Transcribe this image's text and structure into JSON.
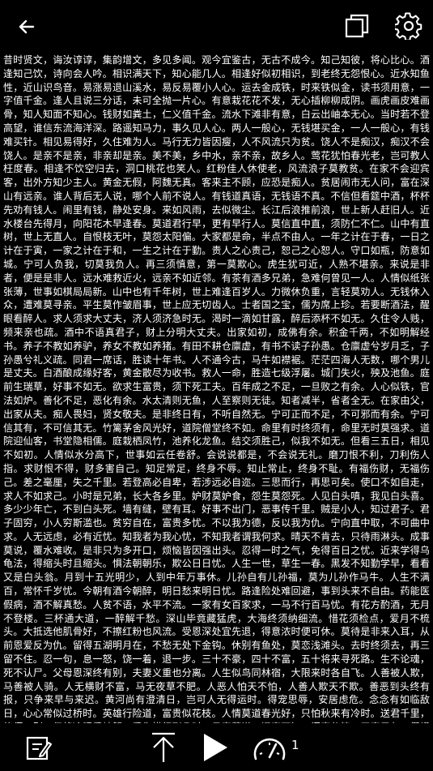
{
  "topbar": {
    "back_icon": "arrow-left-icon",
    "copy_icon": "copy-icon",
    "settings_icon": "gear-icon"
  },
  "content": {
    "text": "昔时贤文，诲汝谆谆，集韵增文，多见多闻。观今宜鉴古，无古不成今。知己知彼，将心比心。酒逢知己饮，诗向会人吟。相识满天下，知心能几人。相逢好似初相识，到老终无怨恨心。近水知鱼性，近山识鸟音。易涨易退山溪水，易反易覆小人心。运去金成铁，时来铁似金，读书须用意，一字值千金。逢人且说三分话，未可全抛一片心。有意栽花花不发，无心插柳柳成阴。画虎画皮难画骨，知人知面不知心。钱财如粪土，仁义值千金。流水下滩非有意，白云出岫本无心。当时若不登高望，谁信东流海洋深。路遥知马力，事久见人心。两人一般心，无钱堪买金，一人一般心，有钱难买针。相见易得好，久住难为人。马行无力皆因瘦，人不风流只为贫。饶人不是痴汉，痴汉不会饶人。是亲不是亲，非亲却是亲。美不美，乡中水，亲不亲，故乡人。莺花犹怕春光老，岂可教人枉度春。相逢不饮空归去，洞口桃花也笑人。红粉佳人休使老，风流浪子莫教贫。在家不会迎宾客，出外方知少主人。黄金无假，阿魏无真。客来主不顾，应恐是痴人。贫居闹市无人问，富在深山有远亲。谁人背后无人说，哪个人前不说人。有钱道真语，无钱语不真。不信但看筵中酒，杯杯先劝有钱人。闹里有钱，静处安身。来如风雨，去似微尘。长江后浪推前浪，世上新人赶旧人。近水楼台先得月，向阳花木早逢春。莫道君行早，更有早行人。莫信直中直，须防仁不仁。山中有直树，世上无直人。自恨枝无叶，莫怨太阳偏。大家都是命，半点不由人。一年之计在于春，一日之计在于寅，一家之计在于和，一生之计在于勤。责人之心责己，恕己之心恕人。守口如瓶，防意如城。宁可人负我，切莫我负人。再三须慎意，第一莫欺心。虎生犹可近，人熟不堪亲。来说是非者，便是是非人。远水难救近火，远亲不如近邻。有茶有酒多兄弟，急难何曾见一人。人情似纸张张薄，世事如棋局局新。山中也有千年树，世上难逢百岁人。力微休负重，言轻莫劝人。无钱休入众，遭难莫寻亲。平生莫作皱眉事，世上应无切齿人。士者国之宝，儒为席上珍。若要断酒法，醒眼看醉人。求人须求大丈夫，济人须济急时无。渴时一滴如甘露，醉后添杯不如无。久住令人贱，频来亲也疏。酒中不语真君子，财上分明大丈夫。出家如初，成佛有余。积金千两，不如明解经书。养子不教如养驴，养女不教如养猪。有田不耕仓廪虚，有书不读子孙愚。仓廪虚兮岁月乏，子孙愚兮礼义疏。同君一席话，胜读十年书。人不通今古，马牛如襟裾。茫茫四海人无数，哪个男儿是丈夫。白酒酿成缘好客，黄金散尽为收书。救人一命，胜造七级浮屠。城门失火，殃及池鱼。庭前生瑞草，好事不如无。欲求生富贵，须下死工夫。百年成之不足，一旦败之有余。人心似铁，官法如炉。善化不足，恶化有余。水太清则无鱼，人至察则无徒。知者减半，省者全无。在家由父，出家从夫。痴人畏妇，贤女敬夫。是非终日有，不听自然无。宁可正而不足，不可邪而有余。宁可信其有，不可信其无。竹篱茅舍风光好，道院僧堂终不如。命里有时终须有，命里无时莫强求。道院迎仙客，书堂隐相儒。庭栽栖凤竹，池养化龙鱼。结交须胜己，似我不如无。但看三五日，相见不如初。人情似水分高下，世事如云任卷舒。会说说都是，不会说无礼。磨刀恨不利，刀利伤人指。求财恨不得，财多害自己。知足常足，终身不辱。知止常止，终身不耻。有福伤财，无福伤己。差之毫厘，失之千里。若登高必自卑，若涉远必自迩。三思而行，再思可矣。使口不如自走，求人不如求己。小时是兄弟，长大各乡里。妒财莫妒食，怨生莫怨死。人见白头嗔，我见白头喜。多少少年亡，不到白头死。墙有缝，壁有耳。好事不出门，恶事传千里。贼是小人，知过君子。君子固穷，小人穷斯滥也。贫穷自在，富贵多忧。不以我为德，反以我为仇。宁向直中取，不可曲中求。人无远虑，必有近忧。知我者为我心忧，不知我者谓我何求。晴天不肯去，只待雨淋头。成事莫说，覆水难收。是非只为多开口，烦恼皆因强出头。忍得一时之气，免得百日之忧。近来学得乌龟法，得缩头时且缩头。惧法朝朝乐，欺公日日忧。人生一世，草生一春。黑发不知勤学早，看看又是白头翁。月到十五光明少，人到中年万事休。儿孙自有儿孙福，莫为儿孙作马牛。人生不满百，常怀千岁忧。今朝有酒今朝醉，明日愁来明日忧。路逢险处难回避，事到头来不自由。药能医假病，酒不解真愁。人贫不语，水平不流。一家有女百家求，一马不行百马忧。有花方酌酒，无月不登楼。三杯通大道，一醉解千愁。深山毕竟藏猛虎，大海终须纳细流。惜花须检点，爱月不梳头。大抵选他肌骨好，不擦红粉也风流。受恩深处宜先退，得意浓时便可休。莫待是非来入耳，从前恩爱反为仇。留得五湖明月在，不愁无处下金钩。休别有鱼处，莫恋浅滩头。去时终须去，再三留不住。忍一句，息一怒，饶一着，退一步。三十不豪，四十不富，五十将来寻死路。生不论魂，死不认尸。父母恩深终有别，夫妻义重也分离。人生似鸟同林宿，大限来时各自飞。人善被人欺，马善被人骑。人无横财不富，马无夜草不肥。人恶人怕天不怕，人善人欺天不欺。善恶到头终有报，只争来早与来迟。黄河尚有澄清日，岂可人无得运时。得宠思辱，安居虑危。念念有如临敌日，心心常似过桥时。英雄行险道，富贵似花枝。人情莫道春光好，只怕秋来有冷时。送君千里，终须一别。但将冷眼看螃蟹，看你横行到几时。见事莫说，问事不知。闲事休管，无事早归。假缎染就真红色，也被旁人说是非。善事可作，恶事莫为。许人一物，千金不移。龙生龙子，虎生豹儿。龙游浅水遭虾戏，虎落平阳被犬欺。一举首登龙虎榜，十年身到凤凰池。十年窗下无人问，一举成名天下知。酒债寻常行处有，人生七十古来稀。养儿待老，积谷防饥。鸡豚狗彘之畜，无失其时。数家之口，可以无饥矣。常将有日思无日，莫把无时当有时。时来风送滕王阁，运去雷轰荐福碑。入门休问荣枯事，观看容颜便得知。官清书吏瘦，神灵庙祝肥。息却雷霆之怒，罢却虎狼之威。饶人算人之本，输人算人之机。好言难得，恶语易施。一言既出，驷马难追。道吾好者是吾贼，道吾恶者是吾师。路逢侠客须呈剑，不是才人莫献诗。三人同行，必有我师，择其善者而从之，其不善者而改之。少壮不努力，老大徒悲伤。人有善愿，天必佑之。莫饮卯时酒，昏昏醉到酉。莫骂酉时妻，一夜受孤凄。种麻得麻，种豆得豆。天眼恢恢，疏而不漏。见官莫向前，做客莫在后。宁添一斗，莫添一口。螳螂捕蝉，岂知黄雀在后。不求金玉重重贵，但愿儿孙个个贤。一日夫妻，百世姻缘。百世修来同船渡，千世修来共枕眠。杀人一万，自损"
  },
  "bottombar": {
    "edit_icon": "edit-icon",
    "top_icon": "arrow-up-to-top-icon",
    "play_icon": "play-icon",
    "speed_icon": "speedometer-icon",
    "speed_value": "1"
  }
}
